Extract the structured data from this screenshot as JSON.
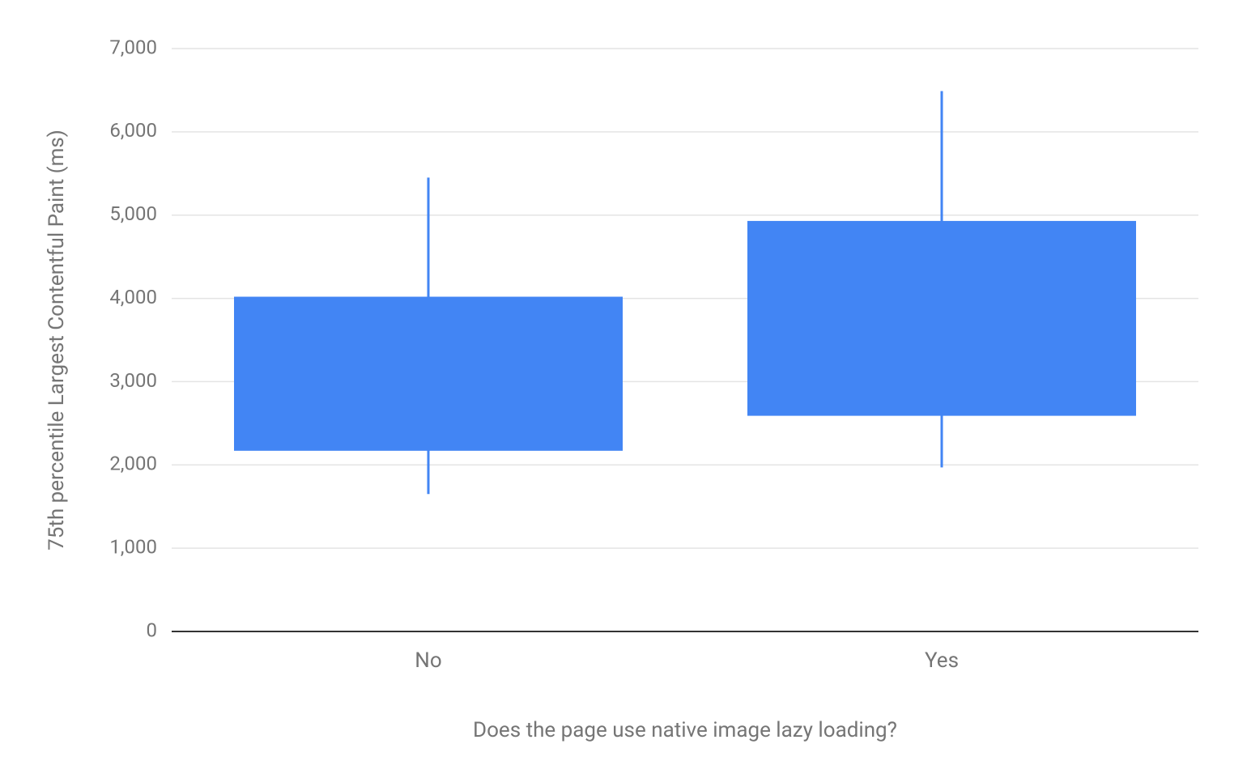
{
  "chart_data": {
    "type": "boxplot",
    "xlabel": "Does the page use native image lazy loading?",
    "ylabel": "75th percentile Largest Contentful Paint (ms)",
    "categories": [
      "No",
      "Yes"
    ],
    "y_ticks": [
      0,
      1000,
      2000,
      3000,
      4000,
      5000,
      6000,
      7000
    ],
    "y_tick_labels": [
      "0",
      "1,000",
      "2,000",
      "3,000",
      "4,000",
      "5,000",
      "6,000",
      "7,000"
    ],
    "ylim": [
      0,
      7000
    ],
    "series": [
      {
        "name": "No",
        "low": 1650,
        "q1": 2170,
        "q3": 4020,
        "high": 5450
      },
      {
        "name": "Yes",
        "low": 1970,
        "q1": 2590,
        "q3": 4930,
        "high": 6490
      }
    ],
    "box_color": "#4285f4"
  }
}
